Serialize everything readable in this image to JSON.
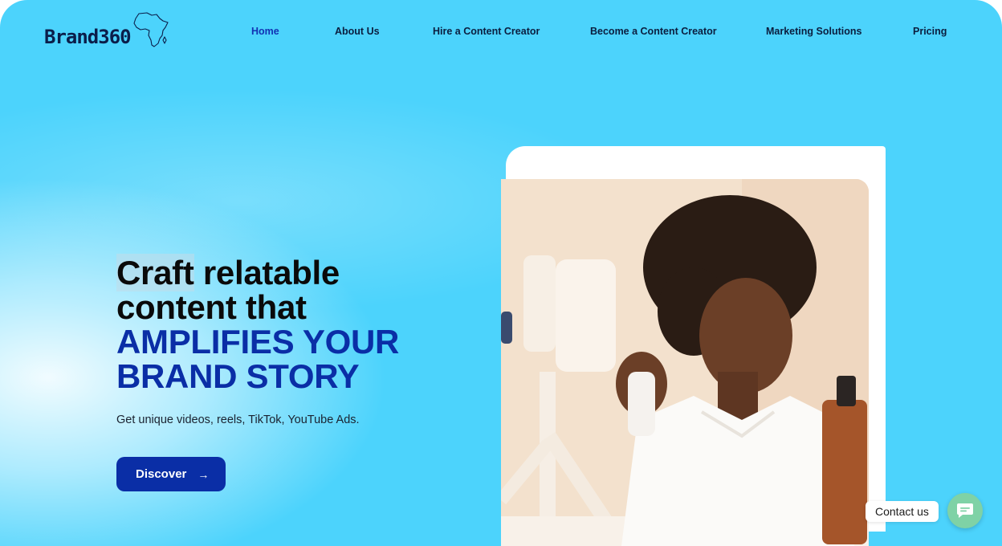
{
  "brand": {
    "name": "Brand360",
    "map_icon": "africa-outline-icon"
  },
  "nav": {
    "items": [
      {
        "label": "Home",
        "active": true
      },
      {
        "label": "About Us",
        "active": false
      },
      {
        "label": "Hire a Content Creator",
        "active": false
      },
      {
        "label": "Become a Content Creator",
        "active": false
      },
      {
        "label": "Marketing Solutions",
        "active": false
      },
      {
        "label": "Pricing",
        "active": false
      }
    ]
  },
  "hero": {
    "title_word_highlight": "Craft",
    "title_line1_rest": " relatable",
    "title_line2": "content that",
    "title_accent_line1": "AMPLIFIES YOUR",
    "title_accent_line2": "BRAND STORY",
    "subtitle": "Get unique videos, reels, TikTok, YouTube Ads.",
    "cta_label": "Discover",
    "cta_icon": "arrow-right-icon"
  },
  "contact": {
    "label": "Contact us",
    "icon": "chat-bubble-icon"
  },
  "colors": {
    "background": "#4cd3fc",
    "accent": "#0a2ea6",
    "nav_active": "#1232b3",
    "contact_button": "#7fd2a6"
  }
}
